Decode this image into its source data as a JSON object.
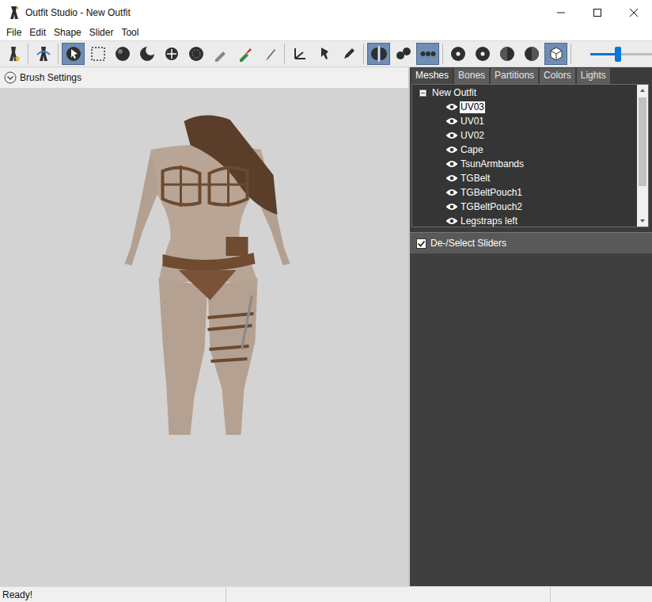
{
  "window": {
    "title": "Outfit Studio - New Outfit"
  },
  "menu": [
    "File",
    "Edit",
    "Shape",
    "Slider",
    "Tool"
  ],
  "toolbar": {
    "groups": [
      [
        {
          "selected": false
        }
      ],
      [
        {
          "selected": false
        }
      ],
      [
        {
          "selected": true
        },
        {
          "selected": false
        },
        {
          "selected": false
        },
        {
          "selected": false
        },
        {
          "selected": false
        },
        {
          "selected": false
        },
        {
          "selected": false
        },
        {
          "selected": false
        },
        {
          "selected": false
        }
      ],
      [
        {
          "selected": false
        },
        {
          "selected": false
        },
        {
          "selected": false
        }
      ],
      [
        {
          "selected": true
        },
        {
          "selected": false
        },
        {
          "selected": true
        }
      ],
      [
        {
          "selected": false
        },
        {
          "selected": false
        },
        {
          "selected": false
        },
        {
          "selected": false
        },
        {
          "selected": true
        }
      ]
    ],
    "brush_size": {
      "level": 0.45
    }
  },
  "brush_settings": {
    "label": "Brush Settings",
    "expanded": false
  },
  "tabs": [
    {
      "label": "Meshes",
      "selected": true
    },
    {
      "label": "Bones",
      "selected": false
    },
    {
      "label": "Partitions",
      "selected": false
    },
    {
      "label": "Colors",
      "selected": false
    },
    {
      "label": "Lights",
      "selected": false
    }
  ],
  "tree": {
    "root": {
      "label": "New Outfit",
      "expanded": true
    },
    "items": [
      {
        "label": "UV03",
        "selected": true,
        "visible": true
      },
      {
        "label": "UV01",
        "selected": false,
        "visible": true
      },
      {
        "label": "UV02",
        "selected": false,
        "visible": true
      },
      {
        "label": "Cape",
        "selected": false,
        "visible": true
      },
      {
        "label": "TsunArmbands",
        "selected": false,
        "visible": true
      },
      {
        "label": "TGBelt",
        "selected": false,
        "visible": true
      },
      {
        "label": "TGBeltPouch1",
        "selected": false,
        "visible": true
      },
      {
        "label": "TGBeltPouch2",
        "selected": false,
        "visible": true
      },
      {
        "label": "Legstraps left",
        "selected": false,
        "visible": true
      }
    ]
  },
  "sliders_header": {
    "label": "De-/Select Sliders",
    "checked": true
  },
  "status_bar": {
    "text": "Ready!"
  }
}
